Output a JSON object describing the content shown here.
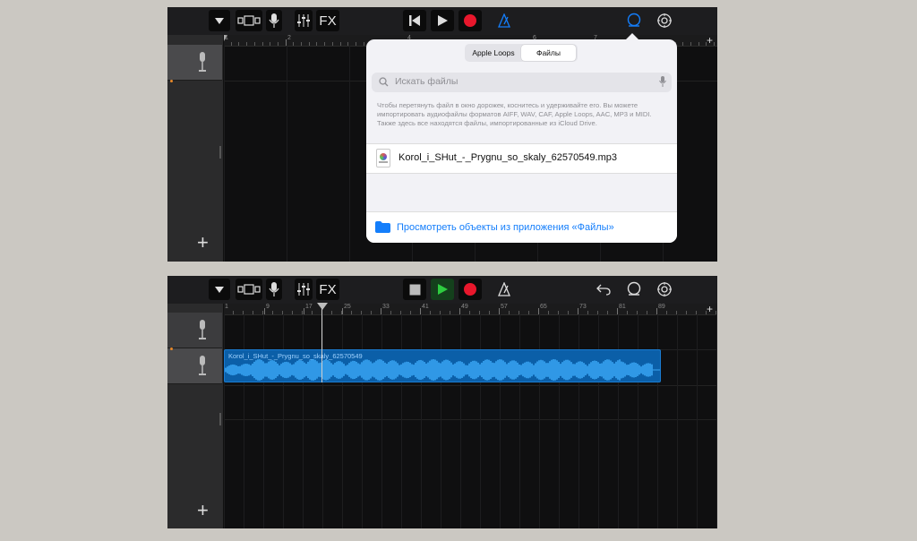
{
  "top_screen": {
    "toolbar": {
      "fx_label": "FX"
    },
    "ruler_numbers": [
      "1",
      "2",
      "4",
      "6",
      "7"
    ],
    "popover": {
      "tabs": [
        "Apple Loops",
        "Файлы"
      ],
      "active_tab": "Файлы",
      "search_placeholder": "Искать файлы",
      "hint_text": "Чтобы перетянуть файл в окно дорожек, коснитесь и удерживайте его. Вы можете импортировать аудиофайлы форматов AIFF, WAV, CAF, Apple Loops, AAC, MP3 и MIDI. Также здесь все находятся файлы, импортированные из iCloud Drive.",
      "file_name": "Korol_i_SHut_-_Prygnu_so_skaly_62570549.mp3",
      "browse_label": "Просмотреть объекты из приложения «Файлы»"
    },
    "add_track_label": "+",
    "ruler_plus": "+"
  },
  "bottom_screen": {
    "toolbar": {
      "fx_label": "FX"
    },
    "ruler_numbers": [
      "1",
      "9",
      "17",
      "25",
      "33",
      "41",
      "49",
      "57",
      "65",
      "73",
      "81",
      "89"
    ],
    "region_name": "Korol_i_SHut_-_Prygnu_so_skaly_62570549",
    "add_track_label": "+",
    "ruler_plus": "+"
  },
  "colors": {
    "accent_blue": "#147efb",
    "record_red": "#e8172c",
    "play_green": "#2ecc40",
    "region_blue": "#0b5fa8",
    "waveform": "#3aa7f5"
  },
  "icons": [
    "track-view-icon",
    "browser-icon",
    "mic-icon",
    "mixer-icon",
    "rewind-icon",
    "play-icon",
    "stop-icon",
    "record-icon",
    "metronome-icon",
    "loop-browser-icon",
    "settings-icon",
    "undo-icon",
    "search-icon",
    "folder-icon",
    "audio-file-icon"
  ]
}
